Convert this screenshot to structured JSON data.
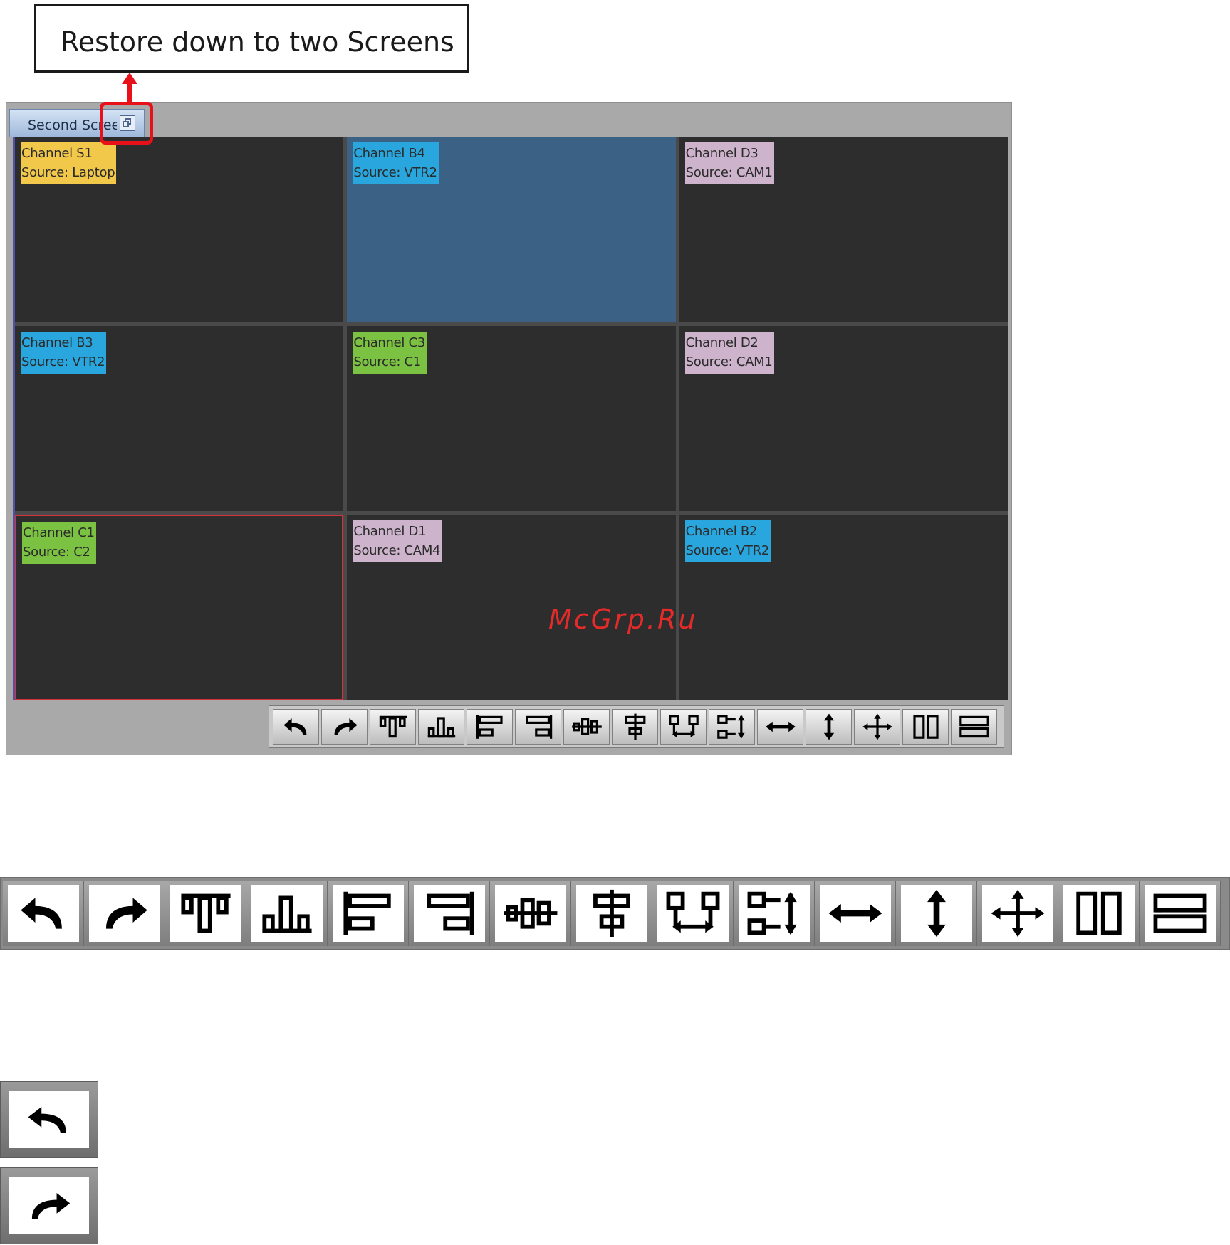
{
  "callout": {
    "text": "Restore down to two Screens"
  },
  "window": {
    "tab_label": "Second Screen",
    "cells": [
      {
        "channel": "Channel S1",
        "source": "Source: Laptop",
        "tag_color": "#f2c84b"
      },
      {
        "channel": "Channel B4",
        "source": "Source: VTR2",
        "tag_color": "#29a6dd",
        "selected": true
      },
      {
        "channel": "Channel D3",
        "source": "Source: CAM1",
        "tag_color": "#cdb4cc"
      },
      {
        "channel": "Channel B3",
        "source": "Source: VTR2",
        "tag_color": "#29a6dd"
      },
      {
        "channel": "Channel C3",
        "source": "Source: C1",
        "tag_color": "#7cc242"
      },
      {
        "channel": "Channel D2",
        "source": "Source: CAM1",
        "tag_color": "#cdb4cc"
      },
      {
        "channel": "Channel C1",
        "source": "Source: C2",
        "tag_color": "#7cc242",
        "active": true
      },
      {
        "channel": "Channel D1",
        "source": "Source: CAM4",
        "tag_color": "#cdb4cc"
      },
      {
        "channel": "Channel B2",
        "source": "Source: VTR2",
        "tag_color": "#29a6dd"
      }
    ]
  },
  "watermark": "McGrp.Ru",
  "toolbar_icons": [
    "undo-icon",
    "redo-icon",
    "align-top-icon",
    "align-bottom-icon",
    "align-left-icon",
    "align-right-icon",
    "align-horizontal-center-icon",
    "align-vertical-center-icon",
    "distribute-horizontal-icon",
    "distribute-vertical-icon",
    "stretch-horizontal-icon",
    "stretch-vertical-icon",
    "stretch-both-icon",
    "split-columns-icon",
    "split-rows-icon"
  ],
  "colors": {
    "highlight": "#e8111a",
    "selected_cell": "#3b6185",
    "active_border": "#d7313d"
  }
}
